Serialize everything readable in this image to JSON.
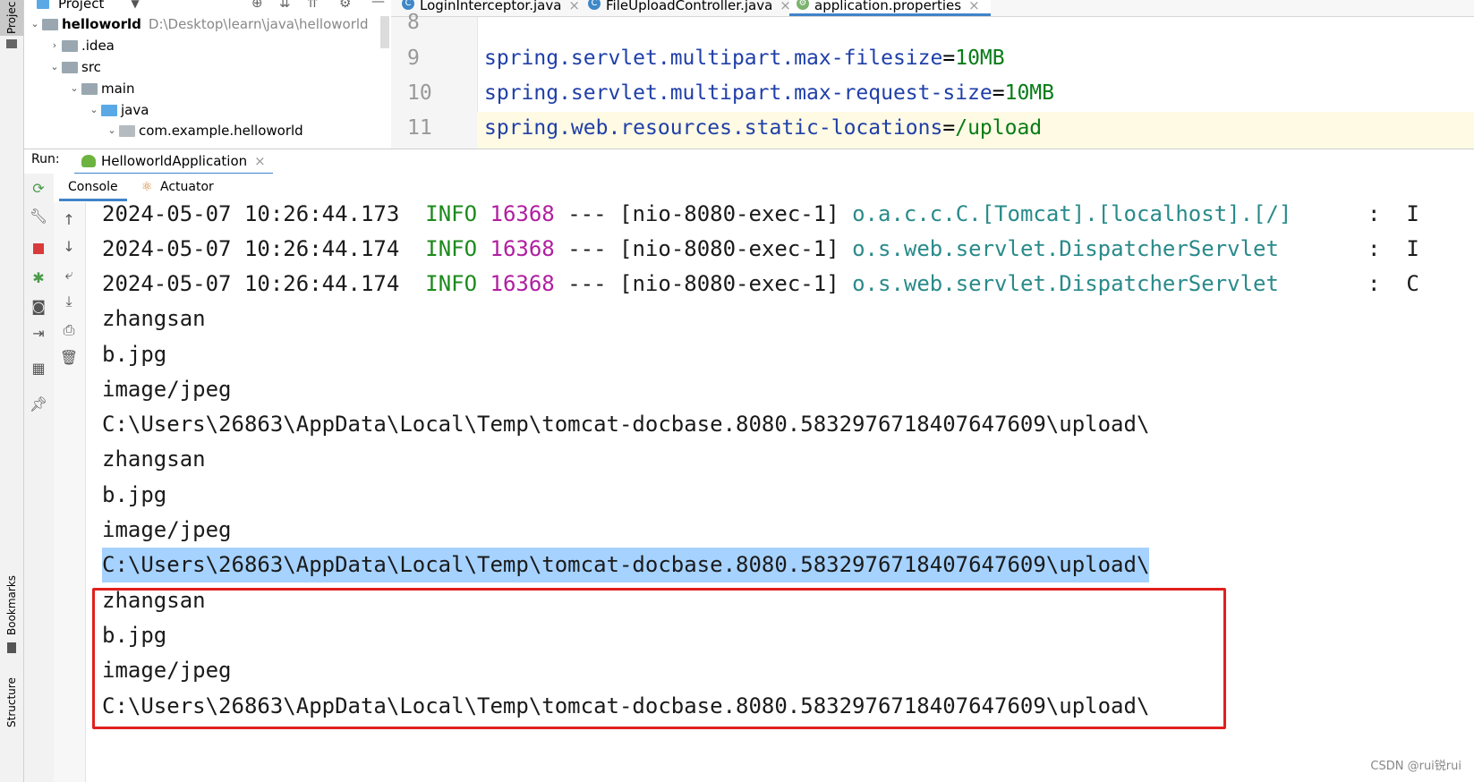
{
  "left_stripe": {
    "project_tab": "Projec",
    "bookmarks_tab": "Bookmarks",
    "structure_tab": "Structure"
  },
  "project_panel": {
    "header": "Project",
    "root": {
      "name": "helloworld",
      "path": "D:\\Desktop\\learn\\java\\helloworld"
    },
    "items": [
      ".idea",
      "src",
      "main",
      "java",
      "com.example.helloworld"
    ]
  },
  "editor": {
    "tabs": [
      "LoginInterceptor.java",
      "FileUploadController.java",
      "application.properties"
    ],
    "line_numbers": [
      "8",
      "9",
      "10",
      "11"
    ],
    "lines": [
      {
        "key": "",
        "value": ""
      },
      {
        "key": "spring.servlet.multipart.max-filesize",
        "value": "10MB"
      },
      {
        "key": "spring.servlet.multipart.max-request-size",
        "value": "10MB"
      },
      {
        "key": "spring.web.resources.static-locations",
        "value": "/upload"
      }
    ]
  },
  "run_bar": {
    "label": "Run:",
    "config": "HelloworldApplication"
  },
  "console_tabs": [
    "Console",
    "Actuator"
  ],
  "console": {
    "logs": [
      {
        "ts": "2024-05-07 10:26:44.173",
        "level": "INFO",
        "pid": "16368",
        "sep": "---",
        "thread": "[nio-8080-exec-1]",
        "logger": "o.a.c.c.C.[Tomcat].[localhost].[/]",
        "tail": ":  I"
      },
      {
        "ts": "2024-05-07 10:26:44.174",
        "level": "INFO",
        "pid": "16368",
        "sep": "---",
        "thread": "[nio-8080-exec-1]",
        "logger": "o.s.web.servlet.DispatcherServlet",
        "tail": ":  I"
      },
      {
        "ts": "2024-05-07 10:26:44.174",
        "level": "INFO",
        "pid": "16368",
        "sep": "---",
        "thread": "[nio-8080-exec-1]",
        "logger": "o.s.web.servlet.DispatcherServlet",
        "tail": ":  C"
      }
    ],
    "output": [
      "zhangsan",
      "b.jpg",
      "image/jpeg",
      "C:\\Users\\26863\\AppData\\Local\\Temp\\tomcat-docbase.8080.5832976718407647609\\upload\\",
      "zhangsan",
      "b.jpg",
      "image/jpeg",
      "C:\\Users\\26863\\AppData\\Local\\Temp\\tomcat-docbase.8080.5832976718407647609\\upload\\",
      "zhangsan",
      "b.jpg",
      "image/jpeg",
      "C:\\Users\\26863\\AppData\\Local\\Temp\\tomcat-docbase.8080.5832976718407647609\\upload\\"
    ]
  },
  "watermark": "CSDN @rui锐rui",
  "colors": {
    "info": "#1c8a1c",
    "pid": "#b01ea0",
    "logger": "#2a8a8a",
    "selection": "#a6d2ff",
    "highlight_box": "#e0201e",
    "property_key": "#1f3fa8",
    "property_value": "#067d17"
  }
}
